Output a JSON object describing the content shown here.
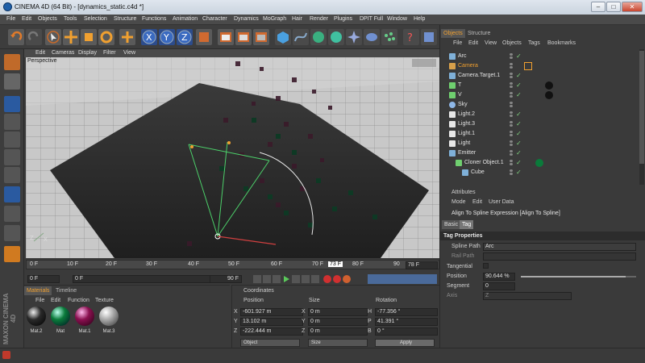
{
  "window": {
    "title": "CINEMA 4D (64 Bit) - [dynamics_static.c4d *]",
    "min": "–",
    "max": "□",
    "close": "✕"
  },
  "menubar": [
    "File",
    "Edit",
    "Objects",
    "Tools",
    "Selection",
    "Structure",
    "Functions",
    "Animation",
    "Character",
    "Dynamics",
    "MoGraph",
    "Hair",
    "Render",
    "Plugins",
    "DPIT Full",
    "Window",
    "Help"
  ],
  "viewport": {
    "menu": [
      "Edit",
      "Cameras",
      "Display",
      "Filter",
      "View"
    ],
    "label": "Perspective"
  },
  "timeline": {
    "ticks": [
      "0 F",
      "10 F",
      "20 F",
      "30 F",
      "40 F",
      "50 F",
      "60 F",
      "70 F",
      "80 F",
      "90"
    ],
    "current": "73 F",
    "end_field": "78 F",
    "start_field": "0 F",
    "start_field2": "0 F",
    "end_field2": "90 F"
  },
  "material": {
    "tabs": [
      "Materials",
      "Timeline"
    ],
    "menu": [
      "File",
      "Edit",
      "Function",
      "Texture"
    ],
    "items": [
      {
        "label": "Mat.2",
        "color": "#1a1a1a"
      },
      {
        "label": "Mat",
        "color": "#0a7a3a"
      },
      {
        "label": "Mat.1",
        "color": "#8a1050"
      },
      {
        "label": "Mat.3",
        "color": "#b8b8b8"
      }
    ]
  },
  "coordinates": {
    "title": "Coordinates",
    "headers": [
      "Position",
      "Size",
      "Rotation"
    ],
    "rows": [
      {
        "axis": "X",
        "pos": "-601.927 m",
        "saxis": "X",
        "size": "0 m",
        "raxis": "H",
        "rot": "-77.356 °"
      },
      {
        "axis": "Y",
        "pos": "13.102 m",
        "saxis": "Y",
        "size": "0 m",
        "raxis": "P",
        "rot": "41.391 °"
      },
      {
        "axis": "Z",
        "pos": "-222.444 m",
        "saxis": "Z",
        "size": "0 m",
        "raxis": "B",
        "rot": "0 °"
      }
    ],
    "mode1": "Object",
    "mode2": "Size",
    "apply": "Apply"
  },
  "objects": {
    "tabs": [
      "Objects",
      "Structure"
    ],
    "menu": [
      "File",
      "Edit",
      "View",
      "Objects",
      "Tags",
      "Bookmarks"
    ],
    "items": [
      {
        "name": "Arc",
        "color": "#7fb0d8"
      },
      {
        "name": "Camera",
        "color": "#d8a04a"
      },
      {
        "name": "Camera.Target.1",
        "color": "#7fb0d8"
      },
      {
        "name": "T",
        "color": "#6fcf6f"
      },
      {
        "name": "V",
        "color": "#6fcf6f"
      },
      {
        "name": "Sky",
        "color": "#8fb8e8"
      },
      {
        "name": "Light.2",
        "color": "#e8e8e8"
      },
      {
        "name": "Light.3",
        "color": "#e8e8e8"
      },
      {
        "name": "Light.1",
        "color": "#e8e8e8"
      },
      {
        "name": "Light",
        "color": "#e8e8e8"
      },
      {
        "name": "Emitter",
        "color": "#7fb0d8"
      },
      {
        "name": "Cloner Object.1",
        "color": "#6fcf6f"
      },
      {
        "name": "Cube",
        "color": "#7fb0d8"
      }
    ]
  },
  "attributes": {
    "title": "Attributes",
    "menu": [
      "Mode",
      "Edit",
      "User Data"
    ],
    "expression": "Align To Spline Expression [Align To Spline]",
    "tabs": [
      "Basic",
      "Tag"
    ],
    "section": "Tag Properties",
    "spline_path_label": "Spline Path",
    "spline_path_value": "Arc",
    "rail_path_label": "Rail Path",
    "tangential_label": "Tangential",
    "position_label": "Position",
    "position_value": "90.644 %",
    "segment_label": "Segment",
    "segment_value": "0",
    "axis_label": "Axis",
    "axis_value": "Z"
  },
  "branding": "MAXON CINEMA 4D"
}
